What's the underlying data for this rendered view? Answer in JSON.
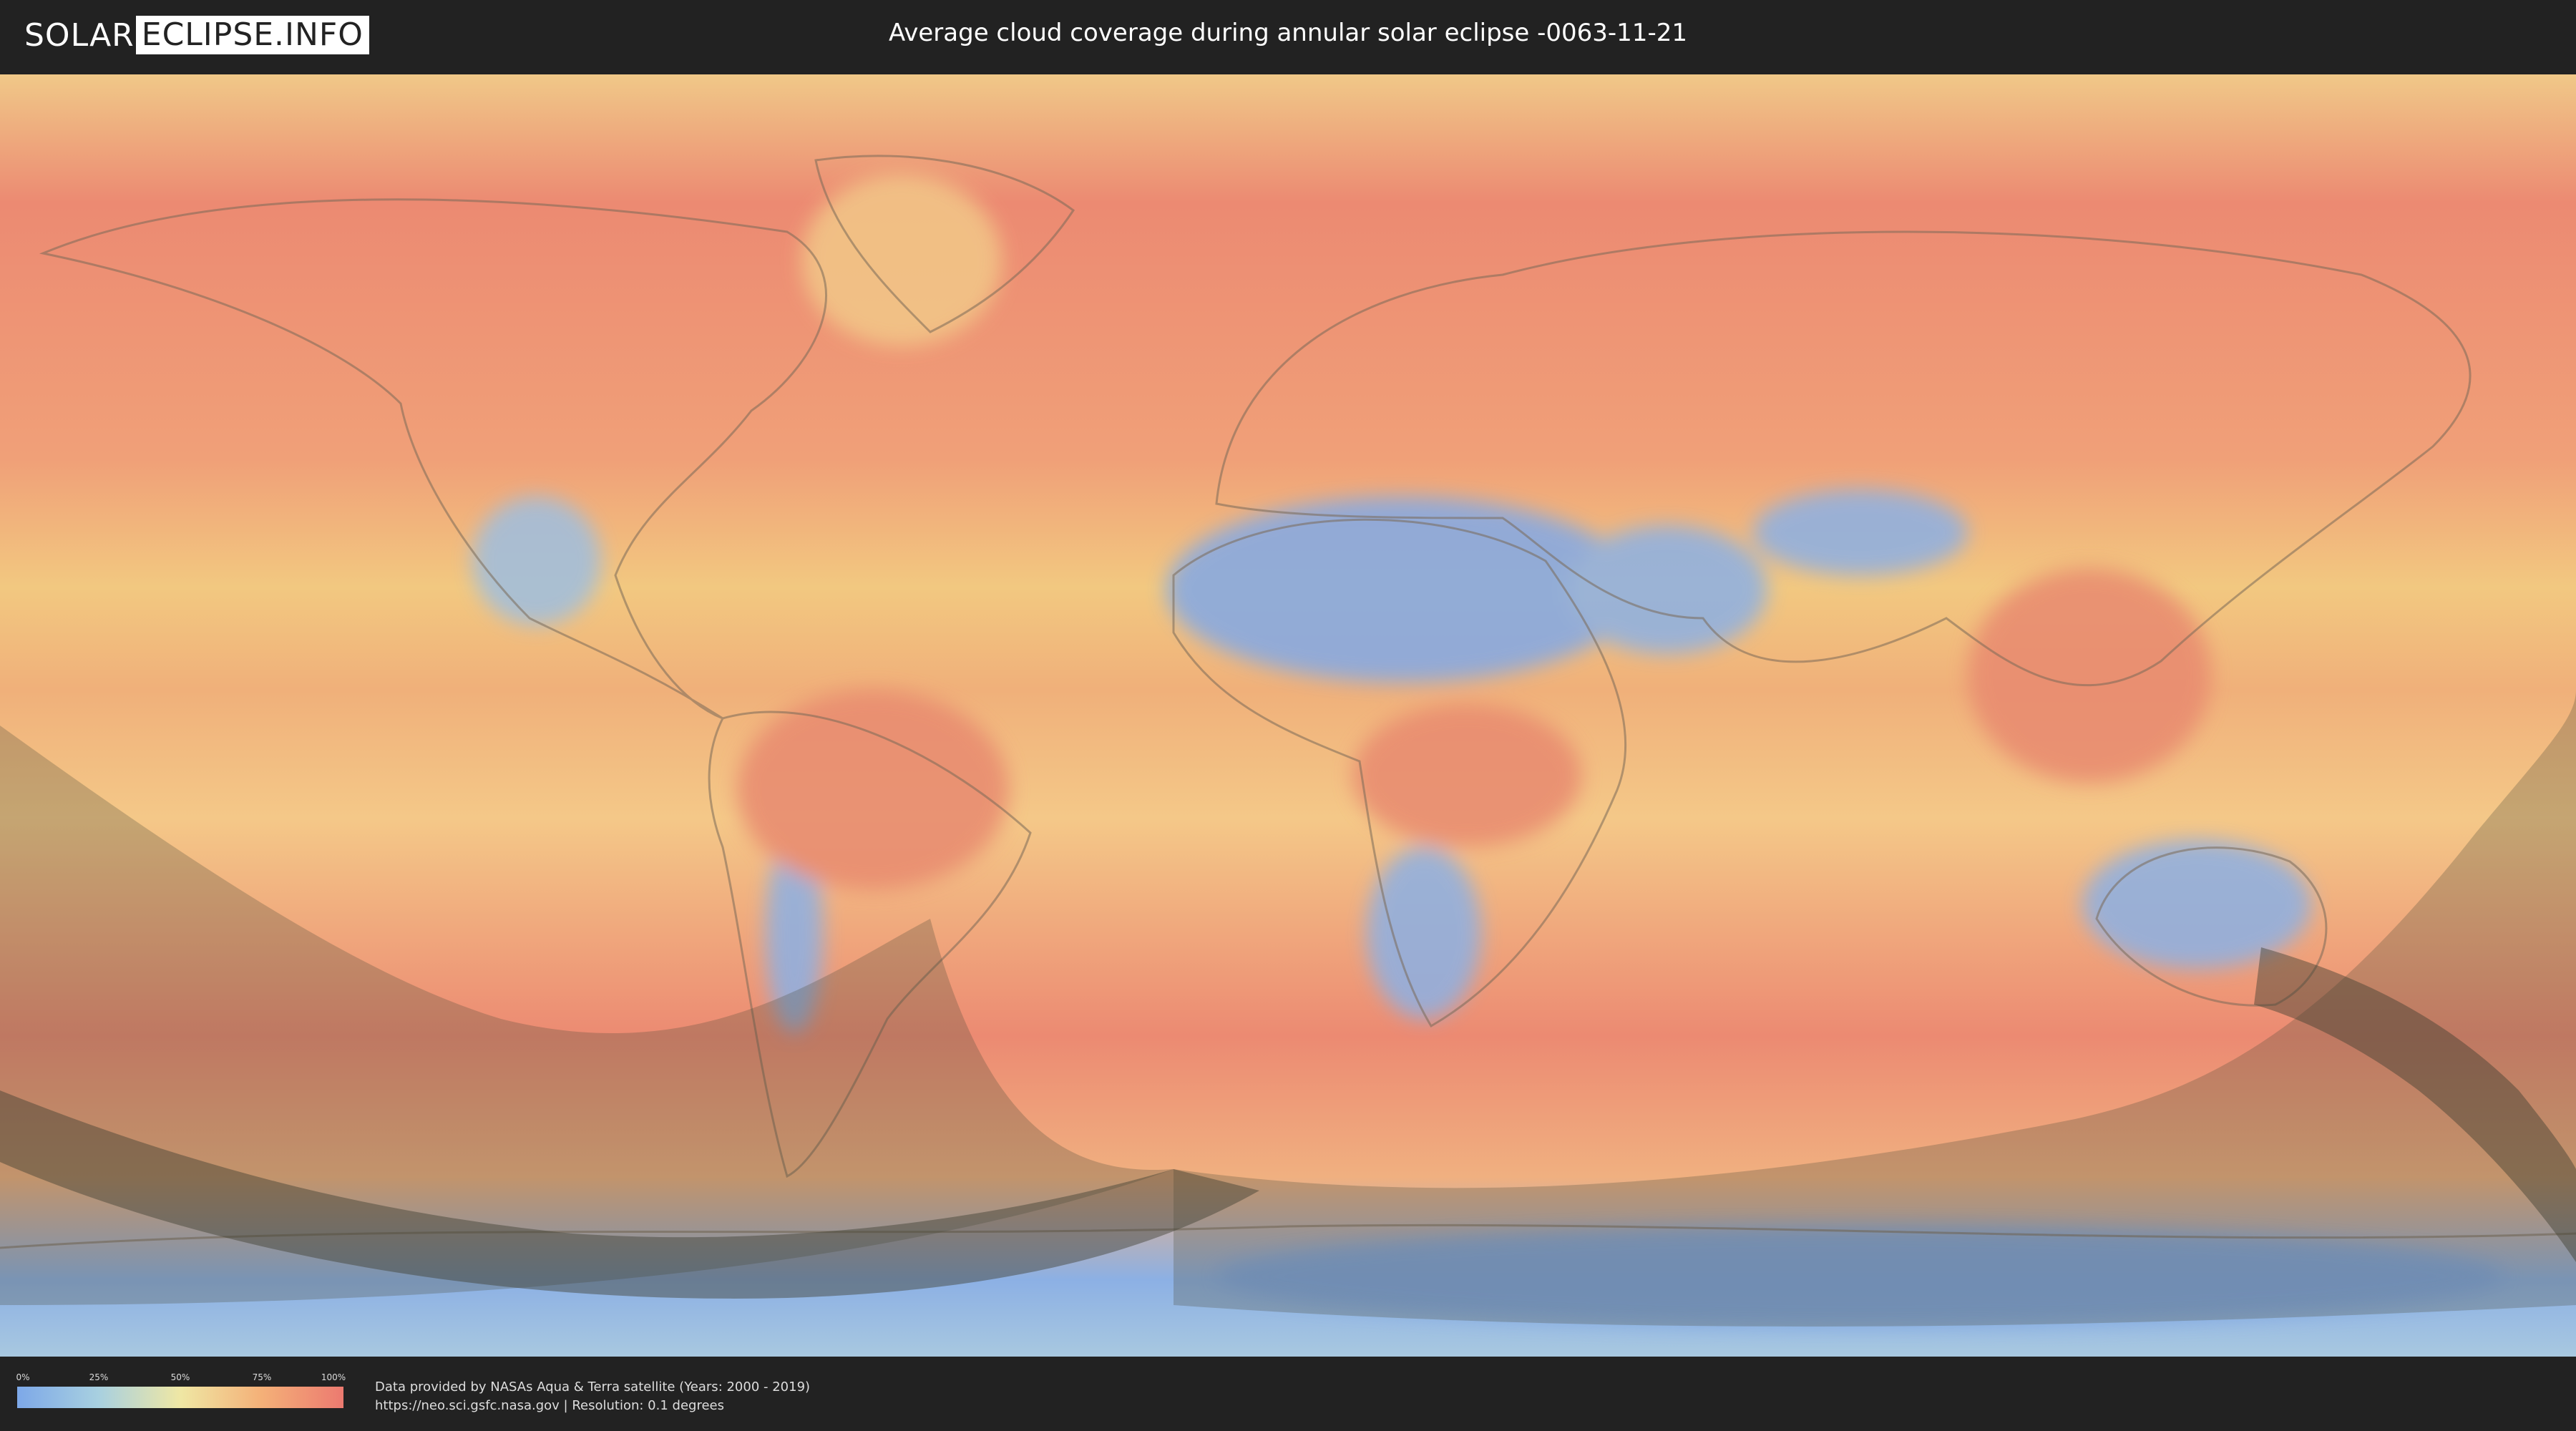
{
  "header": {
    "logo_left": "SOLAR",
    "logo_right": "ECLIPSE.INFO",
    "title": "Average cloud coverage during annular solar eclipse -0063-11-21"
  },
  "map": {
    "kind": "world cloud coverage map",
    "colors": {
      "clear": "#7da8e8",
      "low": "#a8d0e0",
      "mid": "#efe7a4",
      "high": "#f4b078",
      "overcast": "#ec7a70",
      "eclipse_shade": "#5a5a4a"
    }
  },
  "legend": {
    "ticks": [
      "0%",
      "25%",
      "50%",
      "75%",
      "100%"
    ]
  },
  "credits": {
    "line1": "Data provided by NASAs Aqua & Terra satellite (Years: 2000 - 2019)",
    "line2": "https://neo.sci.gsfc.nasa.gov | Resolution: 0.1 degrees"
  }
}
